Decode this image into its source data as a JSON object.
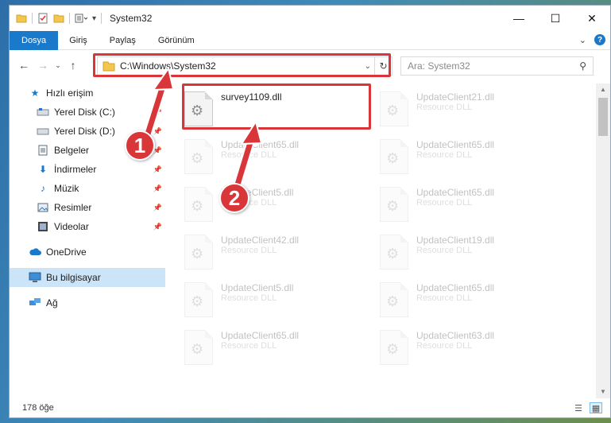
{
  "window": {
    "title": "System32"
  },
  "ribbon": {
    "tabs": [
      {
        "label": "Dosya"
      },
      {
        "label": "Giriş"
      },
      {
        "label": "Paylaş"
      },
      {
        "label": "Görünüm"
      }
    ],
    "help": "?"
  },
  "address": {
    "path": "C:\\Windows\\System32",
    "search_placeholder": "Ara: System32"
  },
  "nav": {
    "items": [
      {
        "label": "Hızlı erişim",
        "icon": "star-icon"
      },
      {
        "label": "Yerel Disk (C:)",
        "icon": "drive-icon",
        "pinned": true
      },
      {
        "label": "Yerel Disk (D:)",
        "icon": "drive-icon",
        "pinned": true
      },
      {
        "label": "Belgeler",
        "icon": "documents-icon",
        "pinned": true
      },
      {
        "label": "İndirmeler",
        "icon": "download-icon",
        "pinned": true
      },
      {
        "label": "Müzik",
        "icon": "music-icon",
        "pinned": true
      },
      {
        "label": "Resimler",
        "icon": "pictures-icon",
        "pinned": true
      },
      {
        "label": "Videolar",
        "icon": "videos-icon",
        "pinned": true
      },
      {
        "label": "OneDrive",
        "icon": "cloud-icon"
      },
      {
        "label": "Bu bilgisayar",
        "icon": "computer-icon",
        "selected": true
      },
      {
        "label": "Ağ",
        "icon": "network-icon"
      }
    ]
  },
  "files": [
    {
      "name": "survey1109.dll",
      "type": ""
    },
    {
      "name": "UpdateClient21.dll",
      "type": "Resource DLL"
    },
    {
      "name": "UpdateClient65.dll",
      "type": "Resource DLL"
    },
    {
      "name": "UpdateClient65.dll",
      "type": "Resource DLL"
    },
    {
      "name": "UpdateClient5.dll",
      "type": "Resource DLL"
    },
    {
      "name": "UpdateClient65.dll",
      "type": "Resource DLL"
    },
    {
      "name": "UpdateClient42.dll",
      "type": "Resource DLL"
    },
    {
      "name": "UpdateClient19.dll",
      "type": "Resource DLL"
    },
    {
      "name": "UpdateClient5.dll",
      "type": "Resource DLL"
    },
    {
      "name": "UpdateClient65.dll",
      "type": "Resource DLL"
    },
    {
      "name": "UpdateClient65.dll",
      "type": "Resource DLL"
    },
    {
      "name": "UpdateClient63.dll",
      "type": "Resource DLL"
    }
  ],
  "status": {
    "count": "178 öğe"
  },
  "callouts": [
    "1",
    "2"
  ],
  "colors": {
    "accent": "#1979ca",
    "highlight": "#d9363a",
    "selected": "#cce4f7"
  }
}
